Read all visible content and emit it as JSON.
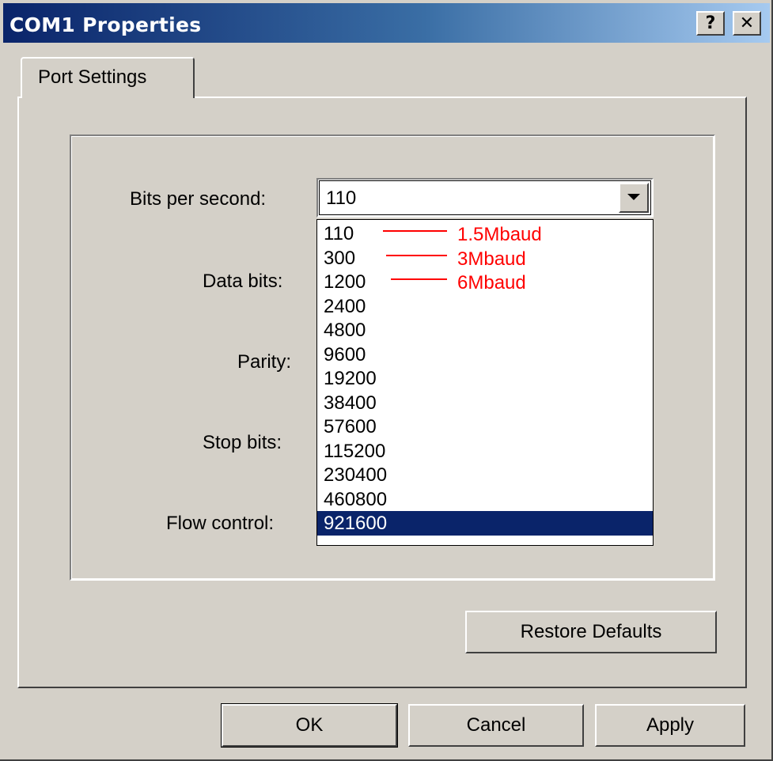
{
  "window": {
    "title": "COM1 Properties",
    "help_label": "?",
    "close_label": "✕"
  },
  "tabs": [
    {
      "label": "Port Settings",
      "active": true
    }
  ],
  "fields": {
    "bits_per_second": {
      "label": "Bits per second:",
      "value": "110"
    },
    "data_bits": {
      "label": "Data bits:"
    },
    "parity": {
      "label": "Parity:"
    },
    "stop_bits": {
      "label": "Stop bits:"
    },
    "flow_control": {
      "label": "Flow control:"
    }
  },
  "dropdown": {
    "options": [
      "110",
      "300",
      "1200",
      "2400",
      "4800",
      "9600",
      "19200",
      "38400",
      "57600",
      "115200",
      "230400",
      "460800",
      "921600"
    ],
    "selected": "921600"
  },
  "annotations": [
    {
      "label": "1.5Mbaud",
      "option": "110"
    },
    {
      "label": "3Mbaud",
      "option": "300"
    },
    {
      "label": "6Mbaud",
      "option": "1200"
    }
  ],
  "buttons": {
    "restore_defaults": "Restore Defaults",
    "ok": "OK",
    "cancel": "Cancel",
    "apply": "Apply"
  },
  "colors": {
    "dialog_bg": "#d4d0c8",
    "titlebar_start": "#0a246a",
    "selection": "#0a246a",
    "annotation": "#ff0000"
  }
}
